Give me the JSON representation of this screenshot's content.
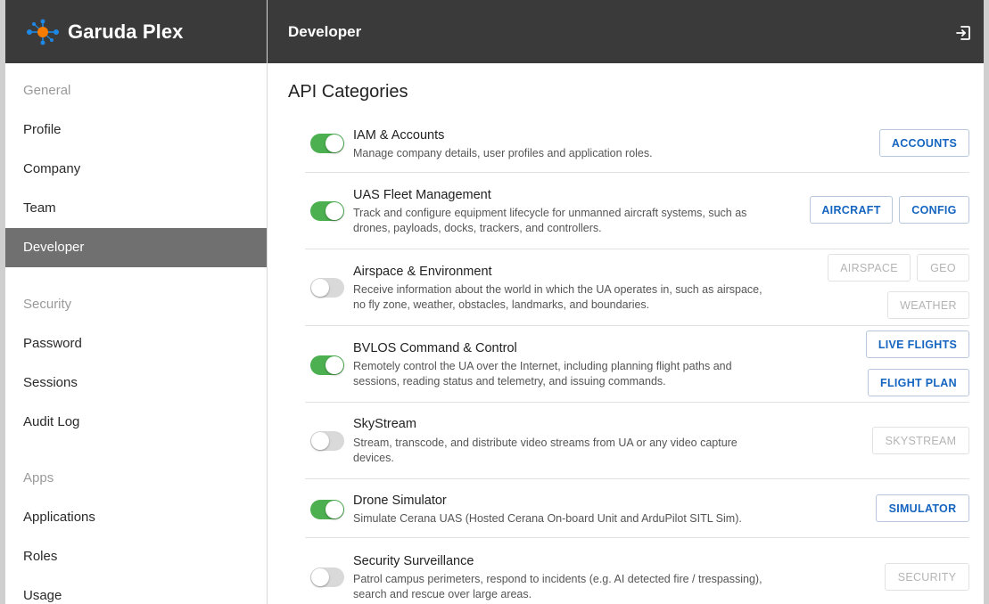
{
  "brand": {
    "name": "Garuda Plex",
    "colors": {
      "accent": "#f57c00",
      "node": "#1e88e5"
    }
  },
  "header": {
    "title": "Developer",
    "logout_icon": "logout-icon"
  },
  "sidebar": {
    "sections": [
      {
        "label": "General",
        "items": [
          "Profile",
          "Company",
          "Team",
          "Developer"
        ]
      },
      {
        "label": "Security",
        "items": [
          "Password",
          "Sessions",
          "Audit Log"
        ]
      },
      {
        "label": "Apps",
        "items": [
          "Applications",
          "Roles",
          "Usage"
        ]
      }
    ],
    "active": "Developer"
  },
  "main": {
    "heading": "API Categories",
    "categories": [
      {
        "name": "IAM & Accounts",
        "enabled": true,
        "desc": "Manage company details, user profiles and application roles.",
        "buttons": [
          "ACCOUNTS"
        ]
      },
      {
        "name": "UAS Fleet Management",
        "enabled": true,
        "desc": "Track and configure equipment lifecycle for unmanned aircraft systems, such as drones, payloads, docks, trackers, and controllers.",
        "buttons": [
          "AIRCRAFT",
          "CONFIG"
        ]
      },
      {
        "name": "Airspace & Environment",
        "enabled": false,
        "desc": "Receive information about the world in which the UA operates in, such as airspace, no fly zone, weather, obstacles, landmarks, and boundaries.",
        "buttons": [
          "AIRSPACE",
          "GEO",
          "WEATHER"
        ]
      },
      {
        "name": "BVLOS Command & Control",
        "enabled": true,
        "desc": "Remotely control the UA over the Internet, including planning flight paths and sessions, reading status and telemetry, and issuing commands.",
        "buttons": [
          "LIVE FLIGHTS",
          "FLIGHT PLAN"
        ]
      },
      {
        "name": "SkyStream",
        "enabled": false,
        "desc": "Stream, transcode, and distribute video streams from UA or any video capture devices.",
        "buttons": [
          "SKYSTREAM"
        ]
      },
      {
        "name": "Drone Simulator",
        "enabled": true,
        "desc": "Simulate Cerana UAS (Hosted Cerana On-board Unit and ArduPilot SITL Sim).",
        "buttons": [
          "SIMULATOR"
        ]
      },
      {
        "name": "Security Surveillance",
        "enabled": false,
        "desc": "Patrol campus perimeters, respond to incidents (e.g. AI detected fire / trespassing), search and rescue over large areas.",
        "buttons": [
          "SECURITY"
        ]
      }
    ]
  }
}
